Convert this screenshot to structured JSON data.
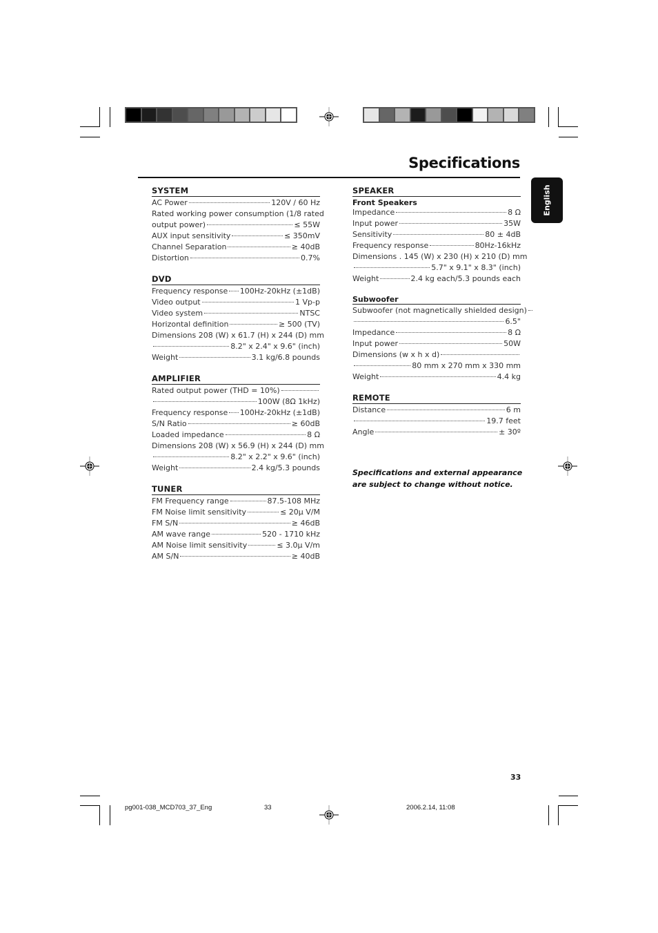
{
  "title": "Specifications",
  "language_tab": "English",
  "color_bars": {
    "left": [
      "#000000",
      "#1c1c1c",
      "#333333",
      "#4d4d4d",
      "#666666",
      "#808080",
      "#999999",
      "#b3b3b3",
      "#cccccc",
      "#e6e6e6",
      "#ffffff"
    ],
    "right": [
      "#e6e6e6",
      "#666666",
      "#b3b3b3",
      "#1c1c1c",
      "#999999",
      "#4d4d4d",
      "#000000",
      "#f2f2f2",
      "#b3b3b3",
      "#d9d9d9",
      "#808080"
    ]
  },
  "left_column": [
    {
      "heading": "SYSTEM",
      "rows": [
        {
          "label": "AC Power",
          "value": "120V / 60 Hz"
        },
        {
          "label": "Rated working power consumption (1/8 rated",
          "value": "",
          "plain": true
        },
        {
          "label": "output power)",
          "value": "≤ 55W"
        },
        {
          "label": "AUX input sensitivity",
          "value": "≤ 350mV"
        },
        {
          "label": "Channel Separation",
          "value": "≥ 40dB"
        },
        {
          "label": "Distortion",
          "value": "0.7%"
        }
      ]
    },
    {
      "heading": "DVD",
      "rows": [
        {
          "label": "Frequency response",
          "value": "100Hz-20kHz (±1dB)"
        },
        {
          "label": "Video output",
          "value": "1 Vp-p"
        },
        {
          "label": "Video system",
          "value": "NTSC"
        },
        {
          "label": "Horizontal definition",
          "value": "≥ 500 (TV)"
        },
        {
          "label": "Dimensions  208 (W) x 61.7 (H) x 244 (D) mm",
          "value": "",
          "plain": true
        },
        {
          "label": "",
          "value": "8.2\" x 2.4\" x 9.6\" (inch)"
        },
        {
          "label": "Weight",
          "value": "3.1 kg/6.8 pounds"
        }
      ]
    },
    {
      "heading": "AMPLIFIER",
      "rows": [
        {
          "label": "Rated output power (THD = 10%)",
          "value": ""
        },
        {
          "label": "",
          "value": "100W (8Ω 1kHz)"
        },
        {
          "label": "Frequency response",
          "value": "100Hz-20kHz (±1dB)"
        },
        {
          "label": "S/N Ratio",
          "value": "≥ 60dB"
        },
        {
          "label": "Loaded impedance",
          "value": "8 Ω"
        },
        {
          "label": "Dimensions  208 (W) x 56.9 (H) x 244 (D) mm",
          "value": "",
          "plain": true
        },
        {
          "label": "",
          "value": "8.2\" x 2.2\" x 9.6\" (inch)"
        },
        {
          "label": "Weight",
          "value": "2.4 kg/5.3 pounds"
        }
      ]
    },
    {
      "heading": "TUNER",
      "rows": [
        {
          "label": "FM Frequency range",
          "value": "87.5-108 MHz"
        },
        {
          "label": "FM Noise limit sensitivity",
          "value": "≤ 20µ V/M"
        },
        {
          "label": "FM S/N",
          "value": "≥ 46dB"
        },
        {
          "label": "AM wave range",
          "value": "520 - 1710 kHz"
        },
        {
          "label": "AM Noise limit sensitivity",
          "value": "≤ 3.0µ V/m"
        },
        {
          "label": "AM S/N",
          "value": "≥ 40dB"
        }
      ]
    }
  ],
  "right_column": [
    {
      "heading": "SPEAKER",
      "subheading": "Front Speakers",
      "rows": [
        {
          "label": "Impedance",
          "value": "8 Ω"
        },
        {
          "label": "Input power",
          "value": "35W"
        },
        {
          "label": "Sensitivity",
          "value": "80 ± 4dB"
        },
        {
          "label": "Frequency response",
          "value": "80Hz-16kHz"
        },
        {
          "label": "Dimensions . 145 (W) x 230 (H) x 210 (D) mm",
          "value": "",
          "plain": true
        },
        {
          "label": "",
          "value": "5.7\" x 9.1\" x 8.3\" (inch)"
        },
        {
          "label": "Weight",
          "value": "2.4 kg each/5.3 pounds each"
        }
      ]
    },
    {
      "subheading_ruled": "Subwoofer",
      "rows": [
        {
          "label": "Subwoofer (not magnetically shielded design)",
          "value": ""
        },
        {
          "label": "",
          "value": "6.5\""
        },
        {
          "label": "Impedance",
          "value": "8 Ω"
        },
        {
          "label": "Input power",
          "value": "50W"
        },
        {
          "label": "Dimensions (w x h x d)",
          "value": ""
        },
        {
          "label": "",
          "value": "80 mm x 270 mm x 330 mm"
        },
        {
          "label": "Weight",
          "value": "4.4 kg"
        }
      ]
    },
    {
      "heading": "REMOTE",
      "rows": [
        {
          "label": "Distance",
          "value": "6 m"
        },
        {
          "label": "",
          "value": "19.7 feet"
        },
        {
          "label": "Angle",
          "value": "± 30º"
        }
      ]
    }
  ],
  "note": [
    "Specifications and external appearance",
    "are subject to change without notice."
  ],
  "page_number": "33",
  "footer": {
    "file": "pg001-038_MCD703_37_Eng",
    "page": "33",
    "date": "2006.2.14, 11:08"
  }
}
